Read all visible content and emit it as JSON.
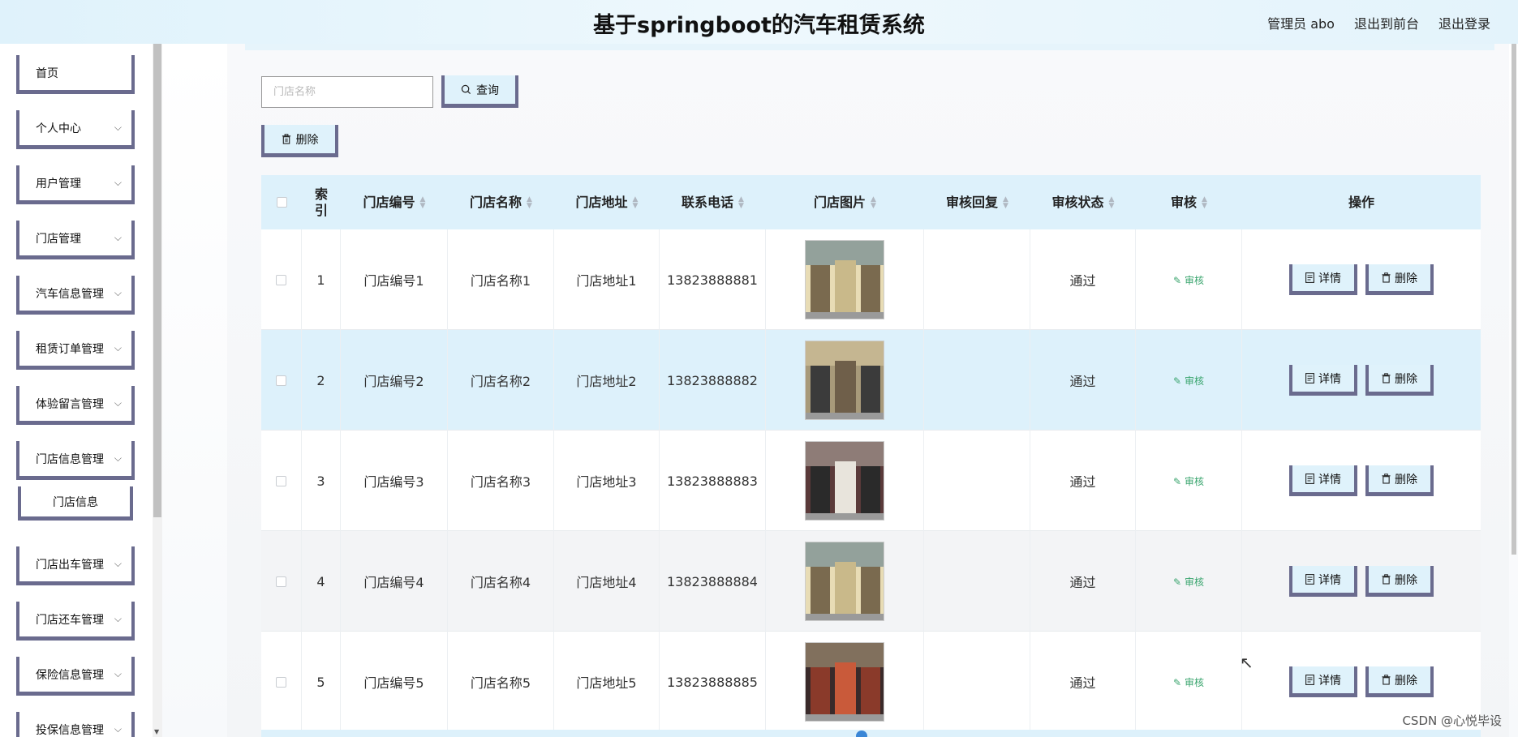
{
  "header": {
    "title": "基于springboot的汽车租赁系统",
    "nav": [
      "管理员 abo",
      "退出到前台",
      "退出登录"
    ]
  },
  "sidebar": {
    "items": [
      {
        "label": "首页",
        "chevron": false
      },
      {
        "label": "个人中心",
        "chevron": true
      },
      {
        "label": "用户管理",
        "chevron": true
      },
      {
        "label": "门店管理",
        "chevron": true
      },
      {
        "label": "汽车信息管理",
        "chevron": true
      },
      {
        "label": "租赁订单管理",
        "chevron": true
      },
      {
        "label": "体验留言管理",
        "chevron": true
      },
      {
        "label": "门店信息管理",
        "chevron": true,
        "open": true
      },
      {
        "label": "门店信息",
        "sub": true
      },
      {
        "label": "门店出车管理",
        "chevron": true
      },
      {
        "label": "门店还车管理",
        "chevron": true
      },
      {
        "label": "保险信息管理",
        "chevron": true
      },
      {
        "label": "投保信息管理",
        "chevron": true
      }
    ]
  },
  "toolbar": {
    "search_placeholder": "门店名称",
    "query_label": "查询",
    "delete_label": "删除"
  },
  "table": {
    "headers": [
      "索引",
      "门店编号",
      "门店名称",
      "门店地址",
      "联系电话",
      "门店图片",
      "审核回复",
      "审核状态",
      "审核",
      "操作"
    ],
    "rows": [
      {
        "index": "1",
        "code": "门店编号1",
        "name": "门店名称1",
        "address": "门店地址1",
        "phone": "13823888881",
        "reply": "",
        "status": "通过"
      },
      {
        "index": "2",
        "code": "门店编号2",
        "name": "门店名称2",
        "address": "门店地址2",
        "phone": "13823888882",
        "reply": "",
        "status": "通过"
      },
      {
        "index": "3",
        "code": "门店编号3",
        "name": "门店名称3",
        "address": "门店地址3",
        "phone": "13823888883",
        "reply": "",
        "status": "通过"
      },
      {
        "index": "4",
        "code": "门店编号4",
        "name": "门店名称4",
        "address": "门店地址4",
        "phone": "13823888884",
        "reply": "",
        "status": "通过"
      },
      {
        "index": "5",
        "code": "门店编号5",
        "name": "门店名称5",
        "address": "门店地址5",
        "phone": "13823888885",
        "reply": "",
        "status": "通过"
      }
    ],
    "audit_label": "审核",
    "detail_label": "详情",
    "row_delete_label": "删除"
  },
  "watermark": "CSDN @心悦毕设",
  "colors": {
    "accent_light": "#ddf1fb",
    "button_border": "#6a6b8e",
    "audit_green": "#3aa56e"
  }
}
